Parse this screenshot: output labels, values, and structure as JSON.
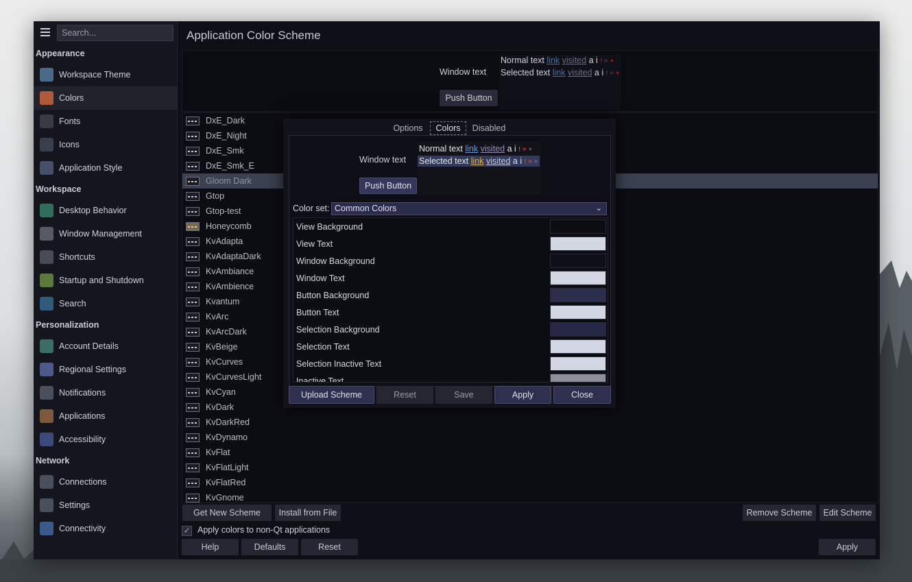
{
  "sidebar": {
    "search_placeholder": "Search...",
    "sections": [
      {
        "title": "Appearance",
        "items": [
          {
            "label": "Workspace Theme",
            "icon": "workspace-theme-icon",
            "color": "#4a6a88"
          },
          {
            "label": "Colors",
            "icon": "colors-icon",
            "color": "#b05a3a",
            "active": true
          },
          {
            "label": "Fonts",
            "icon": "fonts-icon",
            "color": "#3a3a44"
          },
          {
            "label": "Icons",
            "icon": "icons-icon",
            "color": "#3a3f4e"
          },
          {
            "label": "Application Style",
            "icon": "application-style-icon",
            "color": "#46506a"
          }
        ]
      },
      {
        "title": "Workspace",
        "items": [
          {
            "label": "Desktop Behavior",
            "icon": "desktop-behavior-icon",
            "color": "#2f6e5a"
          },
          {
            "label": "Window Management",
            "icon": "window-management-icon",
            "color": "#555a66"
          },
          {
            "label": "Shortcuts",
            "icon": "shortcuts-icon",
            "color": "#474b57"
          },
          {
            "label": "Startup and Shutdown",
            "icon": "startup-shutdown-icon",
            "color": "#5b7a3a"
          },
          {
            "label": "Search",
            "icon": "search-settings-icon",
            "color": "#2f5a7a"
          }
        ]
      },
      {
        "title": "Personalization",
        "items": [
          {
            "label": "Account Details",
            "icon": "account-details-icon",
            "color": "#3d6e66"
          },
          {
            "label": "Regional Settings",
            "icon": "regional-settings-icon",
            "color": "#4a5a8a"
          },
          {
            "label": "Notifications",
            "icon": "notifications-icon",
            "color": "#4a4f5e"
          },
          {
            "label": "Applications",
            "icon": "applications-icon",
            "color": "#7a5a3a"
          },
          {
            "label": "Accessibility",
            "icon": "accessibility-icon",
            "color": "#3a4a7a"
          }
        ]
      },
      {
        "title": "Network",
        "items": [
          {
            "label": "Connections",
            "icon": "connections-icon",
            "color": "#4a4f5e"
          },
          {
            "label": "Settings",
            "icon": "network-settings-icon",
            "color": "#4a4f5e"
          },
          {
            "label": "Connectivity",
            "icon": "connectivity-icon",
            "color": "#3a5a8a"
          }
        ]
      }
    ]
  },
  "main": {
    "title": "Application Color Scheme",
    "preview": {
      "window_text": "Window text",
      "normal_text": "Normal text",
      "selected_text": "Selected text",
      "link": "link",
      "visited": "visited",
      "extras": "a i",
      "marks": "! = +",
      "push_button": "Push Button"
    },
    "schemes": [
      "DxE_Dark",
      "DxE_Night",
      "DxE_Smk",
      "DxE_Smk_E",
      "Gloom Dark",
      "Gtop",
      "Gtop-test",
      "Honeycomb",
      "KvAdapta",
      "KvAdaptaDark",
      "KvAmbiance",
      "KvAmbience",
      "Kvantum",
      "KvArc",
      "KvArcDark",
      "KvBeige",
      "KvCurves",
      "KvCurvesLight",
      "KvCyan",
      "KvDark",
      "KvDarkRed",
      "KvDynamo",
      "KvFlat",
      "KvFlatLight",
      "KvFlatRed",
      "KvGnome"
    ],
    "selected_scheme": "Gloom Dark",
    "buttons": {
      "get_new": "Get New Scheme",
      "install": "Install from File",
      "remove": "Remove Scheme",
      "edit": "Edit Scheme",
      "help": "Help",
      "defaults": "Defaults",
      "reset": "Reset",
      "apply": "Apply"
    },
    "apply_non_qt": "Apply colors to non-Qt applications",
    "apply_non_qt_checked": true
  },
  "dialog": {
    "tabs": [
      "Options",
      "Colors",
      "Disabled"
    ],
    "active_tab": "Colors",
    "preview": {
      "window_text": "Window text",
      "normal_text": "Normal text",
      "selected_text": "Selected text",
      "link": "link",
      "visited": "visited",
      "extras": "a i",
      "marks": "! = +",
      "push_button": "Push Button"
    },
    "color_set_label": "Color set:",
    "color_set_value": "Common Colors",
    "colors": [
      {
        "label": "View Background",
        "color": "#0c0c13"
      },
      {
        "label": "View Text",
        "color": "#d3d7e3"
      },
      {
        "label": "Window Background",
        "color": "#0e0e16"
      },
      {
        "label": "Window Text",
        "color": "#d3d7e3"
      },
      {
        "label": "Button Background",
        "color": "#2c2d4c"
      },
      {
        "label": "Button Text",
        "color": "#d3d7e3"
      },
      {
        "label": "Selection Background",
        "color": "#262846"
      },
      {
        "label": "Selection Text",
        "color": "#d3d7e3"
      },
      {
        "label": "Selection Inactive Text",
        "color": "#d3d7e3"
      },
      {
        "label": "Inactive Text",
        "color": "#8c8e9a"
      }
    ],
    "buttons": {
      "upload": "Upload Scheme",
      "reset": "Reset",
      "save": "Save",
      "apply": "Apply",
      "close": "Close"
    }
  }
}
